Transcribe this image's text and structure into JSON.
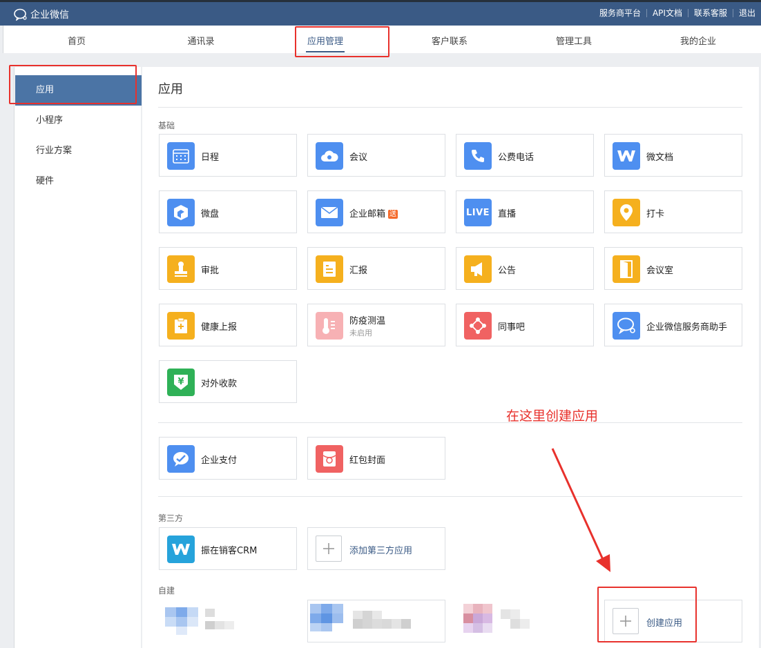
{
  "topbar": {
    "logo_text": "企业微信",
    "links": [
      "服务商平台",
      "API文档",
      "联系客服",
      "退出"
    ]
  },
  "nav": [
    "首页",
    "通讯录",
    "应用管理",
    "客户联系",
    "管理工具",
    "我的企业"
  ],
  "sidebar": [
    "应用",
    "小程序",
    "行业方案",
    "硬件"
  ],
  "main": {
    "title": "应用",
    "sections": {
      "basic": "基础",
      "third_party": "第三方",
      "custom": "自建"
    },
    "basic_apps": [
      {
        "name": "日程",
        "icon": "calendar-icon",
        "color": "#4e8ff0"
      },
      {
        "name": "会议",
        "icon": "cloud-meeting-icon",
        "color": "#4e8ff0"
      },
      {
        "name": "公费电话",
        "icon": "phone-icon",
        "color": "#4e8ff0"
      },
      {
        "name": "微文档",
        "icon": "document-w-icon",
        "color": "#4e8ff0"
      },
      {
        "name": "微盘",
        "icon": "cube-icon",
        "color": "#4e8ff0"
      },
      {
        "name": "企业邮箱",
        "icon": "mail-icon",
        "color": "#4e8ff0",
        "badge": "送"
      },
      {
        "name": "直播",
        "icon": "live-icon",
        "color": "#4e8ff0",
        "icon_text": "LIVE"
      },
      {
        "name": "打卡",
        "icon": "location-pin-icon",
        "color": "#f5b01e"
      },
      {
        "name": "审批",
        "icon": "stamp-icon",
        "color": "#f5b01e"
      },
      {
        "name": "汇报",
        "icon": "report-icon",
        "color": "#f5b01e"
      },
      {
        "name": "公告",
        "icon": "megaphone-icon",
        "color": "#f5b01e"
      },
      {
        "name": "会议室",
        "icon": "door-icon",
        "color": "#f5b01e"
      },
      {
        "name": "健康上报",
        "icon": "health-clipboard-icon",
        "color": "#f5b01e"
      },
      {
        "name": "防疫测温",
        "icon": "thermometer-icon",
        "color": "#f7b1b4",
        "status": "未启用"
      },
      {
        "name": "同事吧",
        "icon": "network-icon",
        "color": "#f06262"
      },
      {
        "name": "企业微信服务商助手",
        "icon": "chat-bubbles-icon",
        "color": "#4e8ff0"
      },
      {
        "name": "对外收款",
        "icon": "yuan-shield-icon",
        "color": "#2fb157",
        "icon_text": "¥"
      }
    ],
    "extra_apps": [
      {
        "name": "企业支付",
        "icon": "payment-icon",
        "color": "#4e8ff0"
      },
      {
        "name": "红包封面",
        "icon": "red-packet-icon",
        "color": "#f06262"
      }
    ],
    "third_party_apps": [
      {
        "name": "振在销客CRM",
        "icon": "crm-w-icon",
        "color": "#26a3db"
      }
    ],
    "add_third_party": "添加第三方应用",
    "create_app": "创建应用",
    "annotation": "在这里创建应用"
  },
  "colors": {
    "topbar": "#3a5a85",
    "sidebar_active": "#4b74a5",
    "annotation_red": "#e8312c"
  }
}
